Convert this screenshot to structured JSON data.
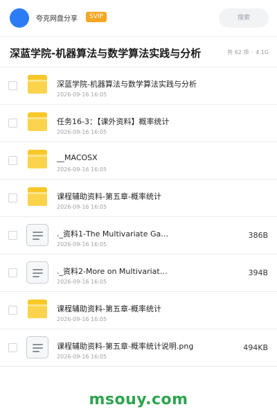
{
  "header": {
    "brand": "夸克网盘分享",
    "badge": "SVIP",
    "search_placeholder": "搜索"
  },
  "folder_title": "深蓝学院-机器算法与数学算法实践与分析",
  "summary": {
    "count": "共 62 项",
    "separator": "·",
    "size": "4.1G"
  },
  "files": [
    {
      "type": "folder",
      "name": "深蓝学院-机器算法与数学算法实践与分析",
      "date": "2026-09-16 16:05",
      "size": ""
    },
    {
      "type": "folder",
      "name": "任务16-3：【课外资料】概率统计",
      "date": "2026-09-16 16:05",
      "size": ""
    },
    {
      "type": "folder",
      "name": "__MACOSX",
      "date": "2026-09-16 16:05",
      "size": ""
    },
    {
      "type": "folder",
      "name": "课程辅助资料-第五章-概率统计",
      "date": "2026-09-16 16:05",
      "size": ""
    },
    {
      "type": "document",
      "name": "._资料1-The Multivariate Ga…",
      "date": "2026-09-16 16:05",
      "size": "386B"
    },
    {
      "type": "document",
      "name": "._资料2-More on Multivariat…",
      "date": "2026-09-16 16:05",
      "size": "394B"
    },
    {
      "type": "folder",
      "name": "课程辅助资料-第五章-概率统计",
      "date": "2026-09-16 16:05",
      "size": ""
    },
    {
      "type": "document",
      "name": "课程辅助资料-第五章-概率统计说明.png",
      "date": "2026-09-16 16:05",
      "size": "494KB"
    }
  ],
  "watermark": "msouy.com"
}
